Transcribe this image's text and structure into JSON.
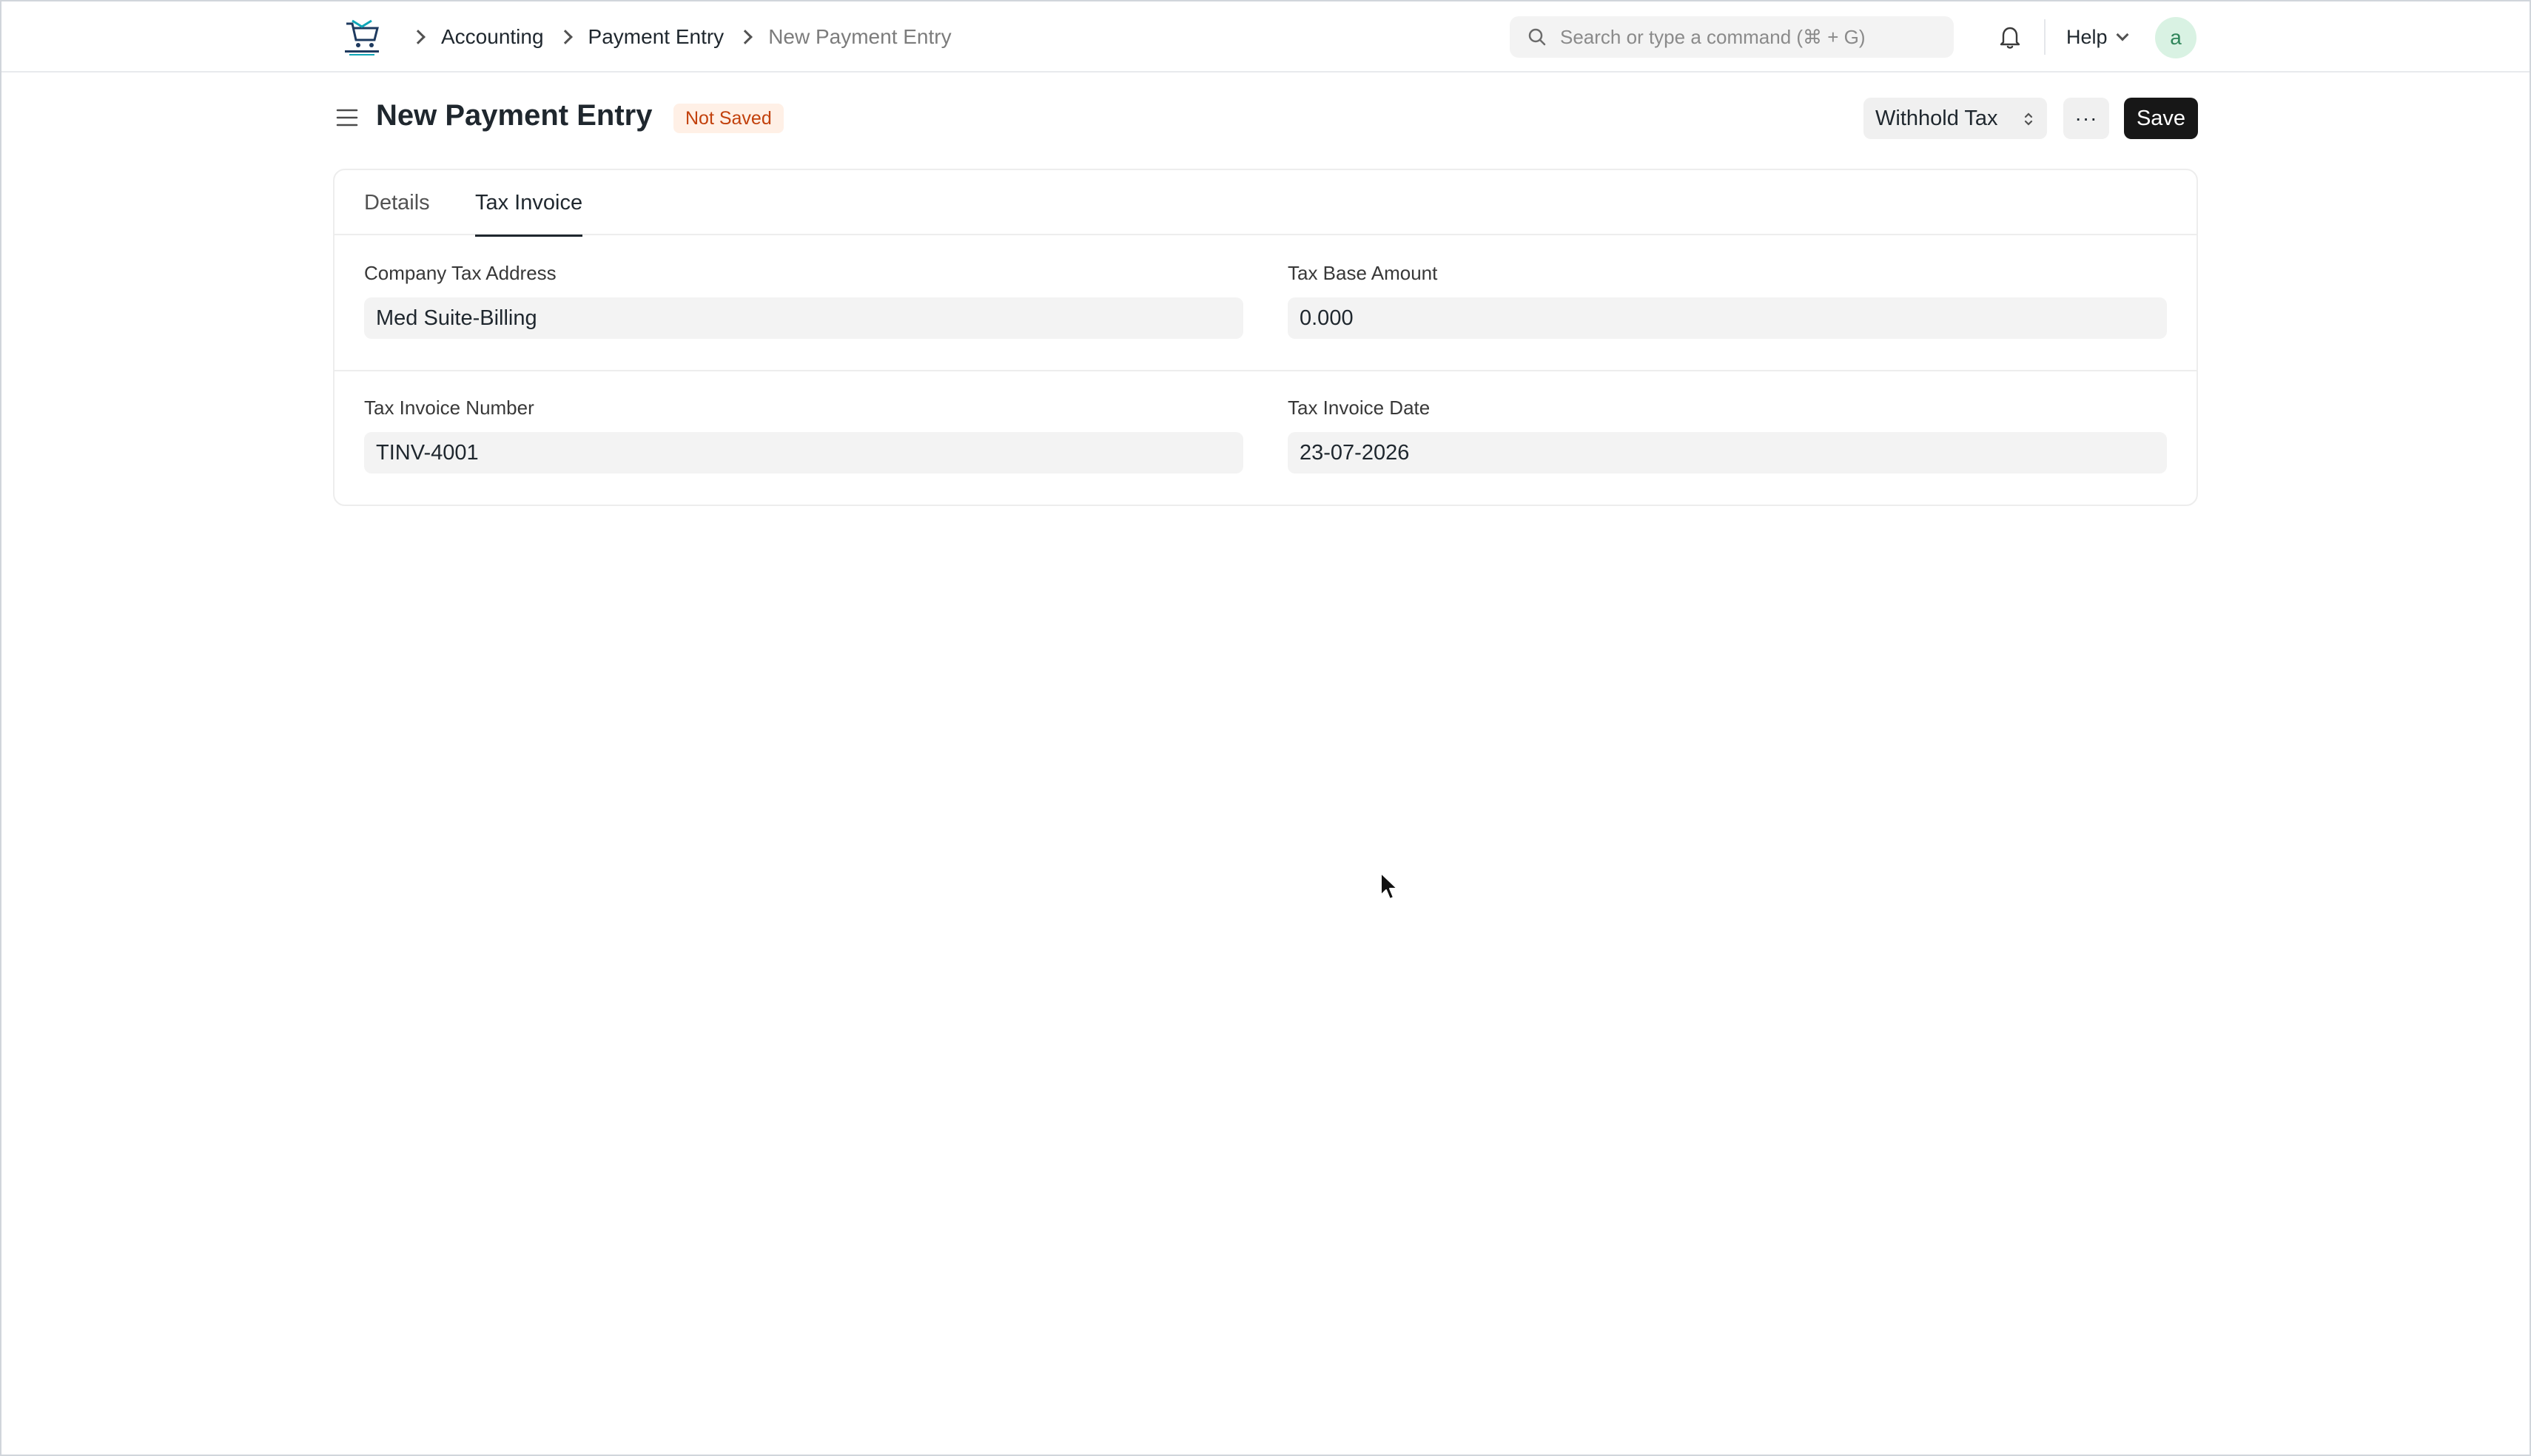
{
  "navbar": {
    "logo_icon": "shopping-cart-logo-icon",
    "breadcrumbs": [
      {
        "label": "Accounting"
      },
      {
        "label": "Payment Entry"
      },
      {
        "label": "New Payment Entry"
      }
    ],
    "search_placeholder": "Search or type a command (⌘ + G)",
    "bell_icon": "bell-icon",
    "help_label": "Help",
    "avatar_letter": "a"
  },
  "page": {
    "title": "New Payment Entry",
    "status_badge": "Not Saved",
    "withhold_tax_label": "Withhold Tax",
    "more_label": "···",
    "save_label": "Save"
  },
  "tabs": [
    {
      "label": "Details",
      "active": false
    },
    {
      "label": "Tax Invoice",
      "active": true
    }
  ],
  "fields": {
    "company_tax_address": {
      "label": "Company Tax Address",
      "value": "Med Suite-Billing"
    },
    "tax_base_amount": {
      "label": "Tax Base Amount",
      "value": "0.000"
    },
    "tax_invoice_number": {
      "label": "Tax Invoice Number",
      "value": "TINV-4001"
    },
    "tax_invoice_date": {
      "label": "Tax Invoice Date",
      "value": "23-07-2026"
    }
  },
  "colors": {
    "primary_button": "#171717",
    "badge_text": "#c2410c",
    "badge_bg": "#fff0e6",
    "avatar_bg": "#d9f2e3"
  }
}
